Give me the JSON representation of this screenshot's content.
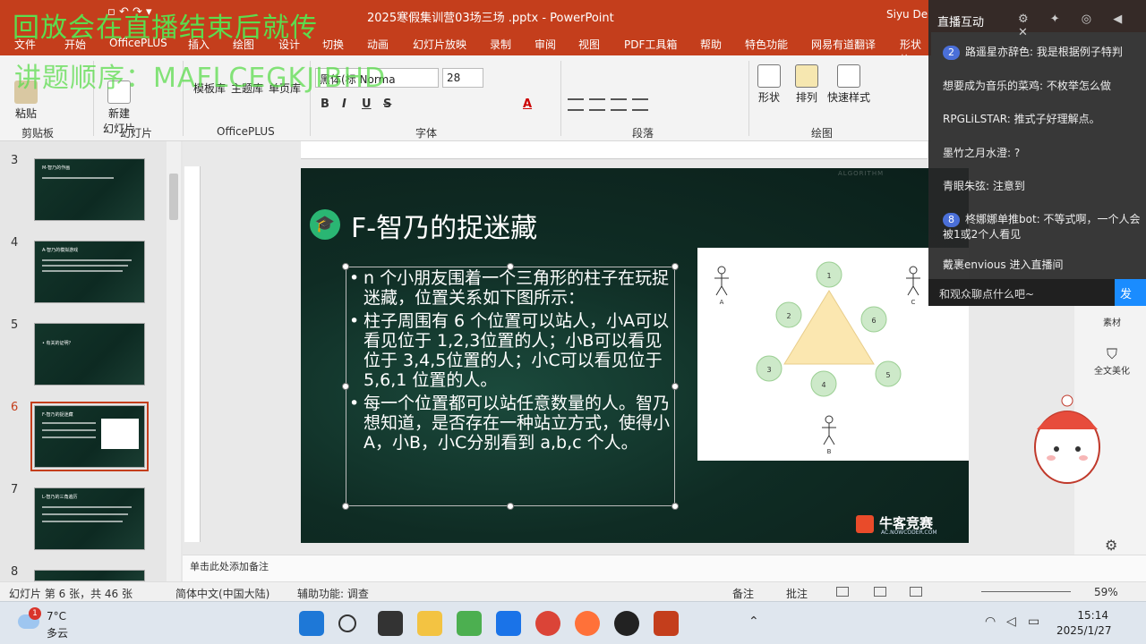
{
  "window": {
    "title": "2025寒假集训营03场三场 .pptx - PowerPoint",
    "user": "Siyu De"
  },
  "overlay": {
    "line1": "回放会在直播结束后就传",
    "line2": "讲题顺序：MAFLCEGKJIBHD"
  },
  "menu": {
    "tabs": [
      "文件",
      "开始",
      "OfficePLUS",
      "插入",
      "绘图",
      "设计",
      "切换",
      "动画",
      "幻灯片放映",
      "录制",
      "审阅",
      "视图",
      "PDF工具箱",
      "帮助",
      "特色功能",
      "网易有道翻译",
      "形状格"
    ]
  },
  "ribbon": {
    "paste_label": "粘贴",
    "new_slide_label": "新建",
    "new_slide_label2": "幻灯片",
    "template_lib": "模板库",
    "theme_lib": "主题库",
    "single_page_lib": "单页库",
    "font_name": "黑体(标 Norma",
    "font_size": "28",
    "shape_label": "形状",
    "arrange_label": "排列",
    "quick_style_label": "快速样式",
    "groups": {
      "clipboard": "剪贴板",
      "slides": "幻灯片",
      "officeplus": "OfficePLUS",
      "font": "字体",
      "paragraph": "段落",
      "drawing": "绘图"
    },
    "format_buttons": [
      "B",
      "I",
      "U",
      "S",
      "A"
    ]
  },
  "thumbnails": [
    {
      "num": "3",
      "title": "M-智乃的作画"
    },
    {
      "num": "4",
      "title": "A-智乃的模拟游戏"
    },
    {
      "num": "5",
      "title": "• 有关的证明？"
    },
    {
      "num": "6",
      "title": "F-智乃的捉迷藏"
    },
    {
      "num": "7",
      "title": "L-智乃的三角遍历"
    },
    {
      "num": "8",
      "title": ""
    }
  ],
  "slide": {
    "title": "F-智乃的捉迷藏",
    "bullets": [
      "n 个小朋友围着一个三角形的柱子在玩捉迷藏，位置关系如下图所示：",
      "柱子周围有 6 个位置可以站人，小A可以看见位于 1,2,3位置的人；小B可以看见位于 3,4,5位置的人；小C可以看见位于 5,6,1 位置的人。",
      "每一个位置都可以站任意数量的人。智乃想知道，是否存在一种站立方式，使得小A，小B，小C分别看到 a,b,c 个人。"
    ],
    "diagram": {
      "positions": [
        "1",
        "2",
        "3",
        "4",
        "5",
        "6"
      ],
      "people": [
        "A",
        "B",
        "C"
      ]
    },
    "brand": "牛客竞赛",
    "brand_sub": "AC.NOWCODER.COM",
    "watermark": "ALGORITHM"
  },
  "chat": {
    "header": "直播互动",
    "messages": [
      {
        "badge": "2",
        "text": "路遥星亦辞色: 我是根据例子特判"
      },
      {
        "badge": "",
        "text": "想要成为音乐的菜鸡: 不枚举怎么做"
      },
      {
        "badge": "",
        "text": "RPGLiLSTAR: 推式子好理解点。"
      },
      {
        "badge": "",
        "text": "墨竹之月水澄: ?"
      },
      {
        "badge": "",
        "text": "青眼朱弦: 注意到"
      },
      {
        "badge": "8",
        "text": "柊娜娜单推bot: 不等式啊，一个人会被1或2个人看见"
      },
      {
        "badge": "",
        "text": "戴裹envious 进入直播间"
      }
    ],
    "input_placeholder": "和观众聊点什么吧~",
    "send_label": "发"
  },
  "side_panel": {
    "items": [
      "素材",
      "全文美化"
    ]
  },
  "notes": {
    "placeholder": "单击此处添加备注"
  },
  "status": {
    "slide_info": "幻灯片 第 6 张，共 46 张",
    "language": "简体中文(中国大陆)",
    "accessibility": "辅助功能: 调查",
    "notes_btn": "备注",
    "comments_btn": "批注",
    "zoom": "59%"
  },
  "taskbar": {
    "weather_badge": "1",
    "temperature": "7°C",
    "weather_desc": "多云",
    "time": "15:14",
    "date": "2025/1/27"
  },
  "colors": {
    "accent": "#c43e1c",
    "overlay_green": "#5cdc4e",
    "slide_bg": "#0f2c24",
    "chat_bg": "#282828",
    "send_blue": "#1a8cff"
  }
}
